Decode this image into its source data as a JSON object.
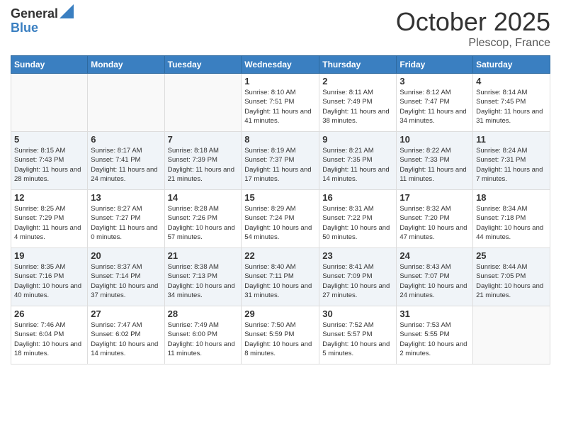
{
  "logo": {
    "general": "General",
    "blue": "Blue"
  },
  "title": "October 2025",
  "location": "Plescop, France",
  "days_of_week": [
    "Sunday",
    "Monday",
    "Tuesday",
    "Wednesday",
    "Thursday",
    "Friday",
    "Saturday"
  ],
  "weeks": [
    [
      {
        "day": "",
        "info": ""
      },
      {
        "day": "",
        "info": ""
      },
      {
        "day": "",
        "info": ""
      },
      {
        "day": "1",
        "info": "Sunrise: 8:10 AM\nSunset: 7:51 PM\nDaylight: 11 hours and 41 minutes."
      },
      {
        "day": "2",
        "info": "Sunrise: 8:11 AM\nSunset: 7:49 PM\nDaylight: 11 hours and 38 minutes."
      },
      {
        "day": "3",
        "info": "Sunrise: 8:12 AM\nSunset: 7:47 PM\nDaylight: 11 hours and 34 minutes."
      },
      {
        "day": "4",
        "info": "Sunrise: 8:14 AM\nSunset: 7:45 PM\nDaylight: 11 hours and 31 minutes."
      }
    ],
    [
      {
        "day": "5",
        "info": "Sunrise: 8:15 AM\nSunset: 7:43 PM\nDaylight: 11 hours and 28 minutes."
      },
      {
        "day": "6",
        "info": "Sunrise: 8:17 AM\nSunset: 7:41 PM\nDaylight: 11 hours and 24 minutes."
      },
      {
        "day": "7",
        "info": "Sunrise: 8:18 AM\nSunset: 7:39 PM\nDaylight: 11 hours and 21 minutes."
      },
      {
        "day": "8",
        "info": "Sunrise: 8:19 AM\nSunset: 7:37 PM\nDaylight: 11 hours and 17 minutes."
      },
      {
        "day": "9",
        "info": "Sunrise: 8:21 AM\nSunset: 7:35 PM\nDaylight: 11 hours and 14 minutes."
      },
      {
        "day": "10",
        "info": "Sunrise: 8:22 AM\nSunset: 7:33 PM\nDaylight: 11 hours and 11 minutes."
      },
      {
        "day": "11",
        "info": "Sunrise: 8:24 AM\nSunset: 7:31 PM\nDaylight: 11 hours and 7 minutes."
      }
    ],
    [
      {
        "day": "12",
        "info": "Sunrise: 8:25 AM\nSunset: 7:29 PM\nDaylight: 11 hours and 4 minutes."
      },
      {
        "day": "13",
        "info": "Sunrise: 8:27 AM\nSunset: 7:27 PM\nDaylight: 11 hours and 0 minutes."
      },
      {
        "day": "14",
        "info": "Sunrise: 8:28 AM\nSunset: 7:26 PM\nDaylight: 10 hours and 57 minutes."
      },
      {
        "day": "15",
        "info": "Sunrise: 8:29 AM\nSunset: 7:24 PM\nDaylight: 10 hours and 54 minutes."
      },
      {
        "day": "16",
        "info": "Sunrise: 8:31 AM\nSunset: 7:22 PM\nDaylight: 10 hours and 50 minutes."
      },
      {
        "day": "17",
        "info": "Sunrise: 8:32 AM\nSunset: 7:20 PM\nDaylight: 10 hours and 47 minutes."
      },
      {
        "day": "18",
        "info": "Sunrise: 8:34 AM\nSunset: 7:18 PM\nDaylight: 10 hours and 44 minutes."
      }
    ],
    [
      {
        "day": "19",
        "info": "Sunrise: 8:35 AM\nSunset: 7:16 PM\nDaylight: 10 hours and 40 minutes."
      },
      {
        "day": "20",
        "info": "Sunrise: 8:37 AM\nSunset: 7:14 PM\nDaylight: 10 hours and 37 minutes."
      },
      {
        "day": "21",
        "info": "Sunrise: 8:38 AM\nSunset: 7:13 PM\nDaylight: 10 hours and 34 minutes."
      },
      {
        "day": "22",
        "info": "Sunrise: 8:40 AM\nSunset: 7:11 PM\nDaylight: 10 hours and 31 minutes."
      },
      {
        "day": "23",
        "info": "Sunrise: 8:41 AM\nSunset: 7:09 PM\nDaylight: 10 hours and 27 minutes."
      },
      {
        "day": "24",
        "info": "Sunrise: 8:43 AM\nSunset: 7:07 PM\nDaylight: 10 hours and 24 minutes."
      },
      {
        "day": "25",
        "info": "Sunrise: 8:44 AM\nSunset: 7:05 PM\nDaylight: 10 hours and 21 minutes."
      }
    ],
    [
      {
        "day": "26",
        "info": "Sunrise: 7:46 AM\nSunset: 6:04 PM\nDaylight: 10 hours and 18 minutes."
      },
      {
        "day": "27",
        "info": "Sunrise: 7:47 AM\nSunset: 6:02 PM\nDaylight: 10 hours and 14 minutes."
      },
      {
        "day": "28",
        "info": "Sunrise: 7:49 AM\nSunset: 6:00 PM\nDaylight: 10 hours and 11 minutes."
      },
      {
        "day": "29",
        "info": "Sunrise: 7:50 AM\nSunset: 5:59 PM\nDaylight: 10 hours and 8 minutes."
      },
      {
        "day": "30",
        "info": "Sunrise: 7:52 AM\nSunset: 5:57 PM\nDaylight: 10 hours and 5 minutes."
      },
      {
        "day": "31",
        "info": "Sunrise: 7:53 AM\nSunset: 5:55 PM\nDaylight: 10 hours and 2 minutes."
      },
      {
        "day": "",
        "info": ""
      }
    ]
  ]
}
